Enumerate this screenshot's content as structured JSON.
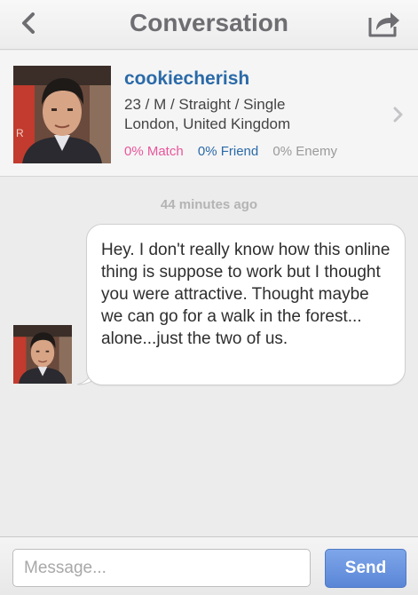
{
  "navbar": {
    "title": "Conversation",
    "back_icon": "chevron-left-icon",
    "share_icon": "share-icon"
  },
  "profile": {
    "username": "cookiecherish",
    "line1": "23 / M / Straight / Single",
    "line2": "London, United Kingdom",
    "match": "0% Match",
    "friend": "0% Friend",
    "enemy": "0% Enemy",
    "photo_icon": "profile-photo",
    "chevron_icon": "chevron-right-icon"
  },
  "conversation": {
    "timestamp": "44 minutes ago",
    "messages": [
      {
        "text": "Hey. I don't really know how this online thing is suppose to work but I thought you were attractive. Thought maybe we can go for a walk in the forest... alone...just the two of us."
      }
    ]
  },
  "composer": {
    "placeholder": "Message...",
    "send_label": "Send"
  },
  "colors": {
    "username": "#2b6aa8",
    "match": "#e9569b",
    "friend": "#2b6aa8",
    "enemy": "#9a9a9a",
    "send_button": "#5a86d6"
  }
}
